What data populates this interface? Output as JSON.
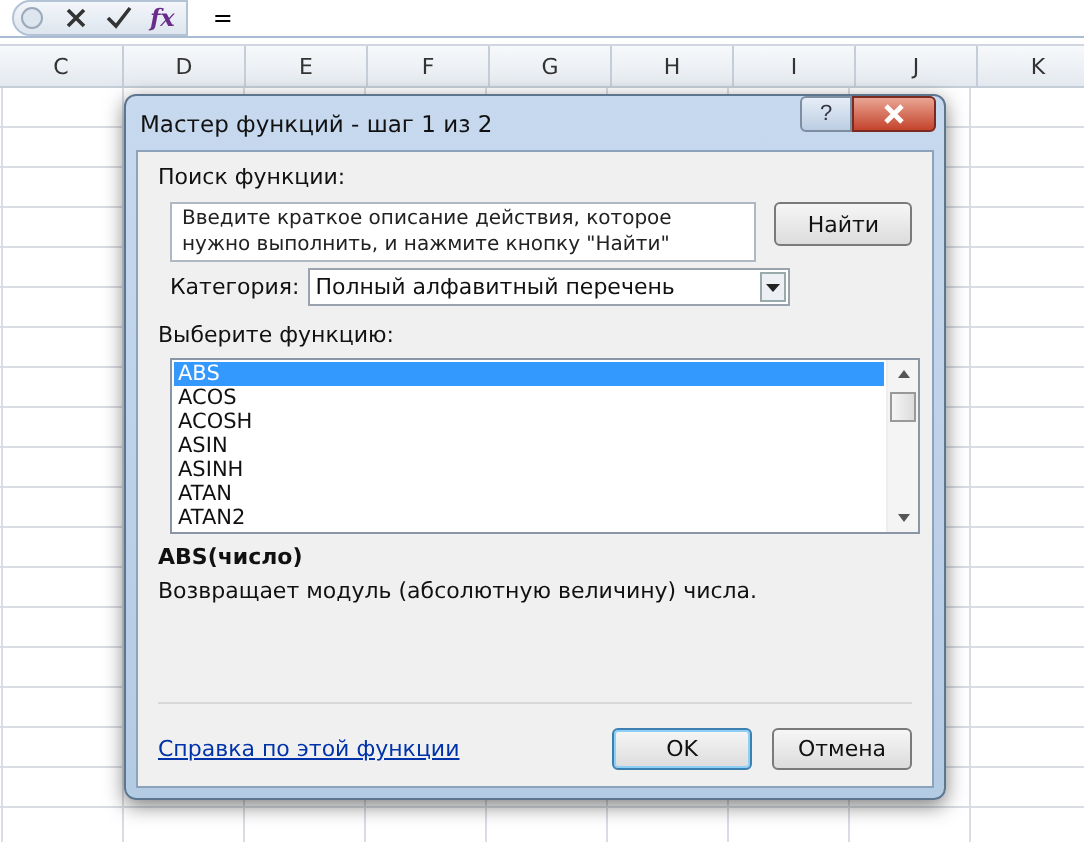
{
  "formula_bar": {
    "function_button": "fx",
    "value": "="
  },
  "columns": [
    "C",
    "D",
    "E",
    "F",
    "G",
    "H",
    "I",
    "J",
    "K"
  ],
  "dialog": {
    "title": "Мастер функций - шаг 1 из 2",
    "help_button": "?",
    "search_label": "Поиск функции:",
    "search_field": {
      "value": "Введите краткое описание действия, которое нужно выполнить, и нажмите кнопку \"Найти\""
    },
    "find_button": "Найти",
    "category_label": "Категория:",
    "category_select": "Полный алфавитный перечень",
    "list_label": "Выберите функцию:",
    "functions": [
      {
        "name": "ABS",
        "selected": true
      },
      {
        "name": "ACOS",
        "selected": false
      },
      {
        "name": "ACOSH",
        "selected": false
      },
      {
        "name": "ASIN",
        "selected": false
      },
      {
        "name": "ASINH",
        "selected": false
      },
      {
        "name": "ATAN",
        "selected": false
      },
      {
        "name": "ATAN2",
        "selected": false
      }
    ],
    "signature": "ABS(число)",
    "description": "Возвращает модуль (абсолютную величину) числа.",
    "help_link": "Справка по этой функции",
    "buttons": [
      {
        "label": "OK",
        "default": true
      },
      {
        "label": "Отмена",
        "default": false
      }
    ]
  }
}
